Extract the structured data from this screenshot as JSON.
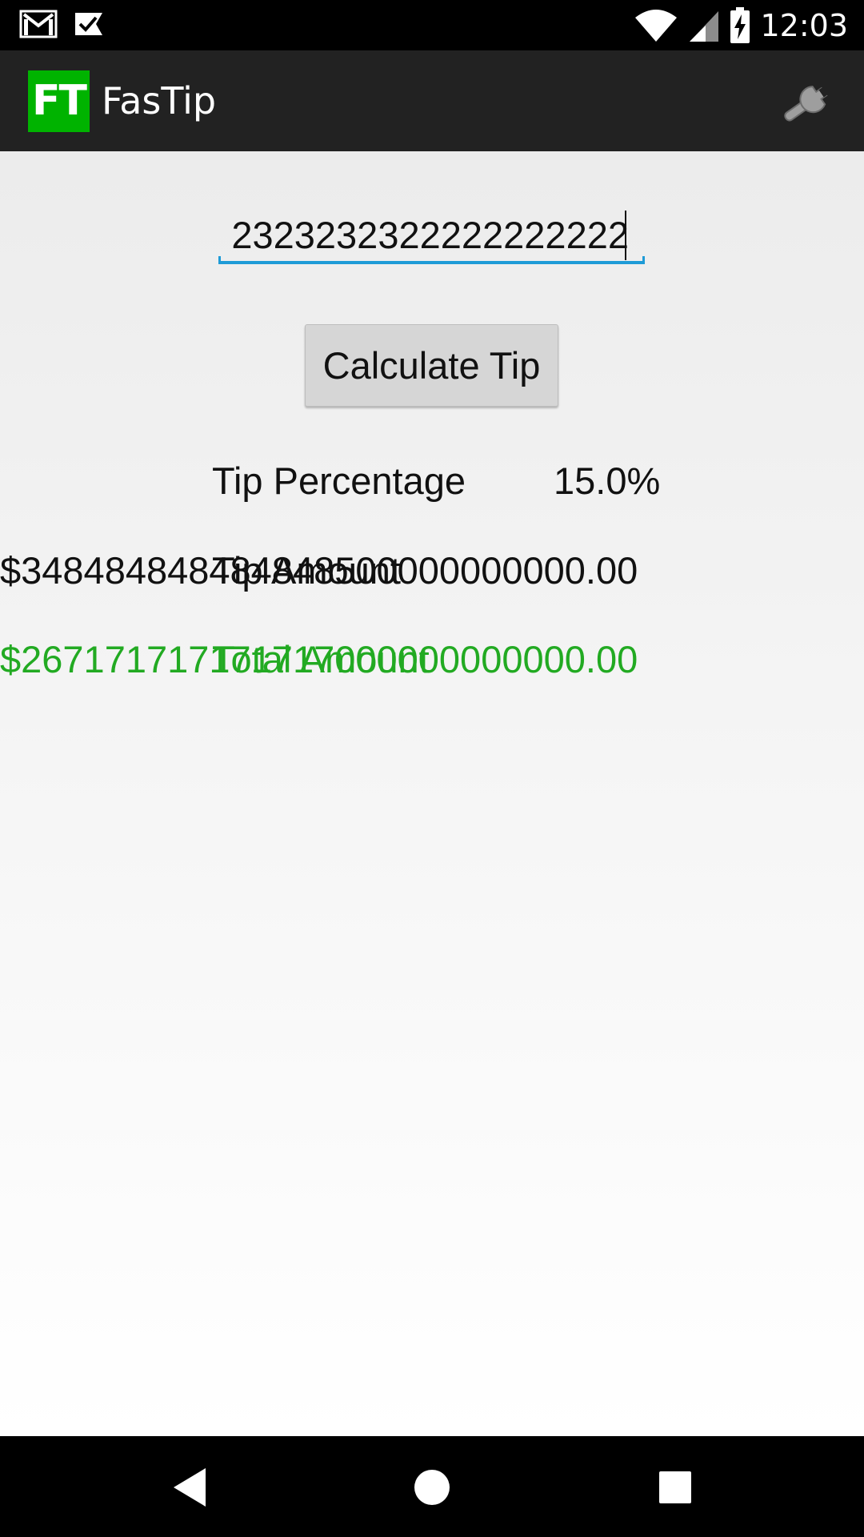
{
  "status_bar": {
    "time": "12:03",
    "icons": [
      "gmail-icon",
      "checkmark-task-icon",
      "wifi-icon",
      "cell-signal-icon",
      "battery-charging-icon"
    ]
  },
  "app_bar": {
    "logo_text": "FT",
    "title": "FasTip",
    "settings_icon": "wrench-icon",
    "logo_color": "#00b300"
  },
  "form": {
    "bill_value": "2323232322222222222",
    "calculate_label": "Calculate Tip"
  },
  "results": {
    "tip_percentage_label": "Tip Percentage",
    "tip_percentage_value": "15.0%",
    "tip_amount_label": "Tip Amount",
    "tip_amount_value": "$348484848484848500000000000.00",
    "total_amount_label": "Total Amount",
    "total_amount_value": "$267171717171717000000000000.00",
    "total_color": "#22aa22"
  },
  "nav_bar": {
    "icons": [
      "back-icon",
      "home-icon",
      "recent-apps-icon"
    ]
  }
}
